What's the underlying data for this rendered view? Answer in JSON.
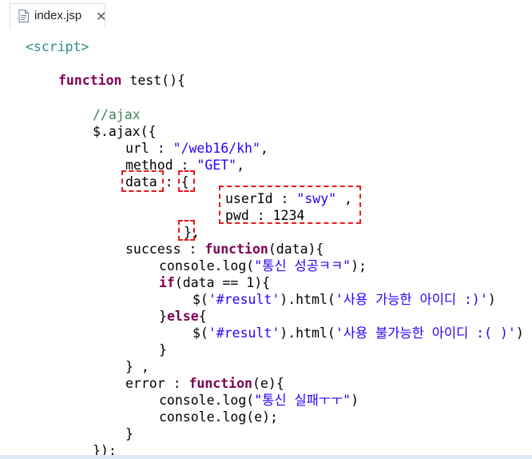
{
  "tab": {
    "filename": "index.jsp",
    "close_icon": "close-icon",
    "file_icon": "jsp-file-icon"
  },
  "code": {
    "script_open": "<script>",
    "fn_keyword": "function",
    "fn_signature": " test(){",
    "comment_ajax": "//ajax",
    "ajax_call": "$.ajax({",
    "url_key": "url : ",
    "url_value": "\"/web16/kh\"",
    "url_comma": ",",
    "method_key": "method : ",
    "method_value": "\"GET\"",
    "method_comma": ",",
    "data_key": "data",
    "data_sep": " : ",
    "data_open": "{",
    "userid_key": "userId : ",
    "userid_value": "\"swy\"",
    "userid_comma": " ,",
    "pwd_line": "pwd : 1234",
    "data_close": "},",
    "success_key": "success : ",
    "success_fn": "function",
    "success_args": "(data){",
    "log1_call": "console.log(",
    "log1_str": "\"통신 성공ㅋㅋ\"",
    "log1_end": ");",
    "if_kw": "if",
    "if_cond": "(data == 1){",
    "html1_a": "$(",
    "html1_sel": "'#result'",
    "html1_b": ").html(",
    "html1_str": "'사용 가능한 아이디 :)'",
    "html1_end": ")",
    "else_open": "}",
    "else_kw": "else",
    "else_brace": "{",
    "html2_a": "$(",
    "html2_sel": "'#result'",
    "html2_b": ").html(",
    "html2_str": "'사용 불가능한 아이디 :( )'",
    "html2_end": ")",
    "if_close": "}",
    "success_close": "} ,",
    "error_key": "error : ",
    "error_fn": "function",
    "error_args": "(e){",
    "log2_call": "console.log(",
    "log2_str": "\"통신 실패ㅜㅜ\"",
    "log2_end": ")",
    "log3": "console.log(e);",
    "error_close": "}",
    "ajax_close": "});"
  },
  "colors": {
    "highlight": "#e8191c",
    "keyword": "#7f0055",
    "string": "#2a00ff",
    "tag": "#2d8b88",
    "comment": "#3f7f5f"
  }
}
